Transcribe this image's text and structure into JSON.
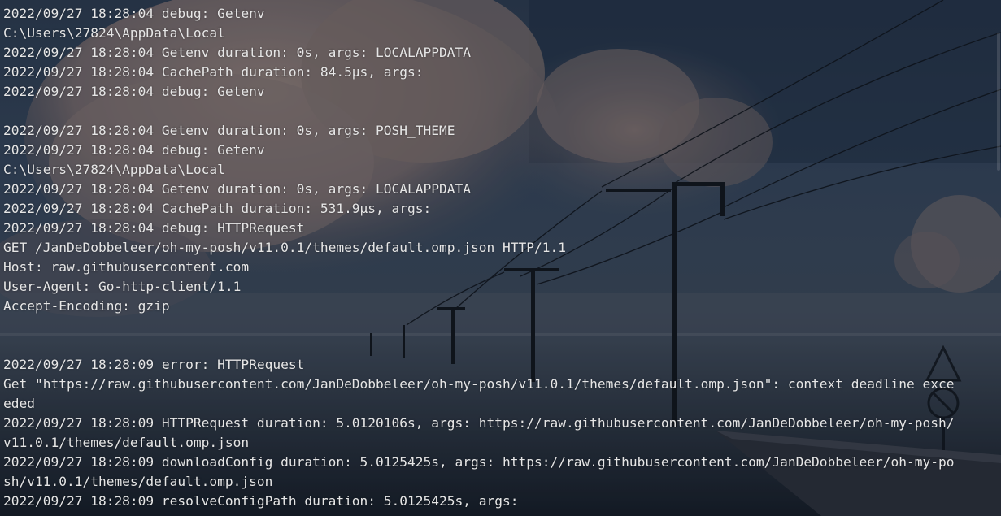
{
  "terminal": {
    "lines": [
      "2022/09/27 18:28:04 debug: Getenv",
      "C:\\Users\\27824\\AppData\\Local",
      "2022/09/27 18:28:04 Getenv duration: 0s, args: LOCALAPPDATA",
      "2022/09/27 18:28:04 CachePath duration: 84.5µs, args:",
      "2022/09/27 18:28:04 debug: Getenv",
      "",
      "2022/09/27 18:28:04 Getenv duration: 0s, args: POSH_THEME",
      "2022/09/27 18:28:04 debug: Getenv",
      "C:\\Users\\27824\\AppData\\Local",
      "2022/09/27 18:28:04 Getenv duration: 0s, args: LOCALAPPDATA",
      "2022/09/27 18:28:04 CachePath duration: 531.9µs, args:",
      "2022/09/27 18:28:04 debug: HTTPRequest",
      "GET /JanDeDobbeleer/oh-my-posh/v11.0.1/themes/default.omp.json HTTP/1.1",
      "Host: raw.githubusercontent.com",
      "User-Agent: Go-http-client/1.1",
      "Accept-Encoding: gzip",
      "",
      "",
      "2022/09/27 18:28:09 error: HTTPRequest",
      "Get \"https://raw.githubusercontent.com/JanDeDobbeleer/oh-my-posh/v11.0.1/themes/default.omp.json\": context deadline exce",
      "eded",
      "2022/09/27 18:28:09 HTTPRequest duration: 5.0120106s, args: https://raw.githubusercontent.com/JanDeDobbeleer/oh-my-posh/",
      "v11.0.1/themes/default.omp.json",
      "2022/09/27 18:28:09 downloadConfig duration: 5.0125425s, args: https://raw.githubusercontent.com/JanDeDobbeleer/oh-my-po",
      "sh/v11.0.1/themes/default.omp.json",
      "2022/09/27 18:28:09 resolveConfigPath duration: 5.0125425s, args:"
    ]
  },
  "colors": {
    "text": "#e6e6e6",
    "background": "#1a2433"
  }
}
